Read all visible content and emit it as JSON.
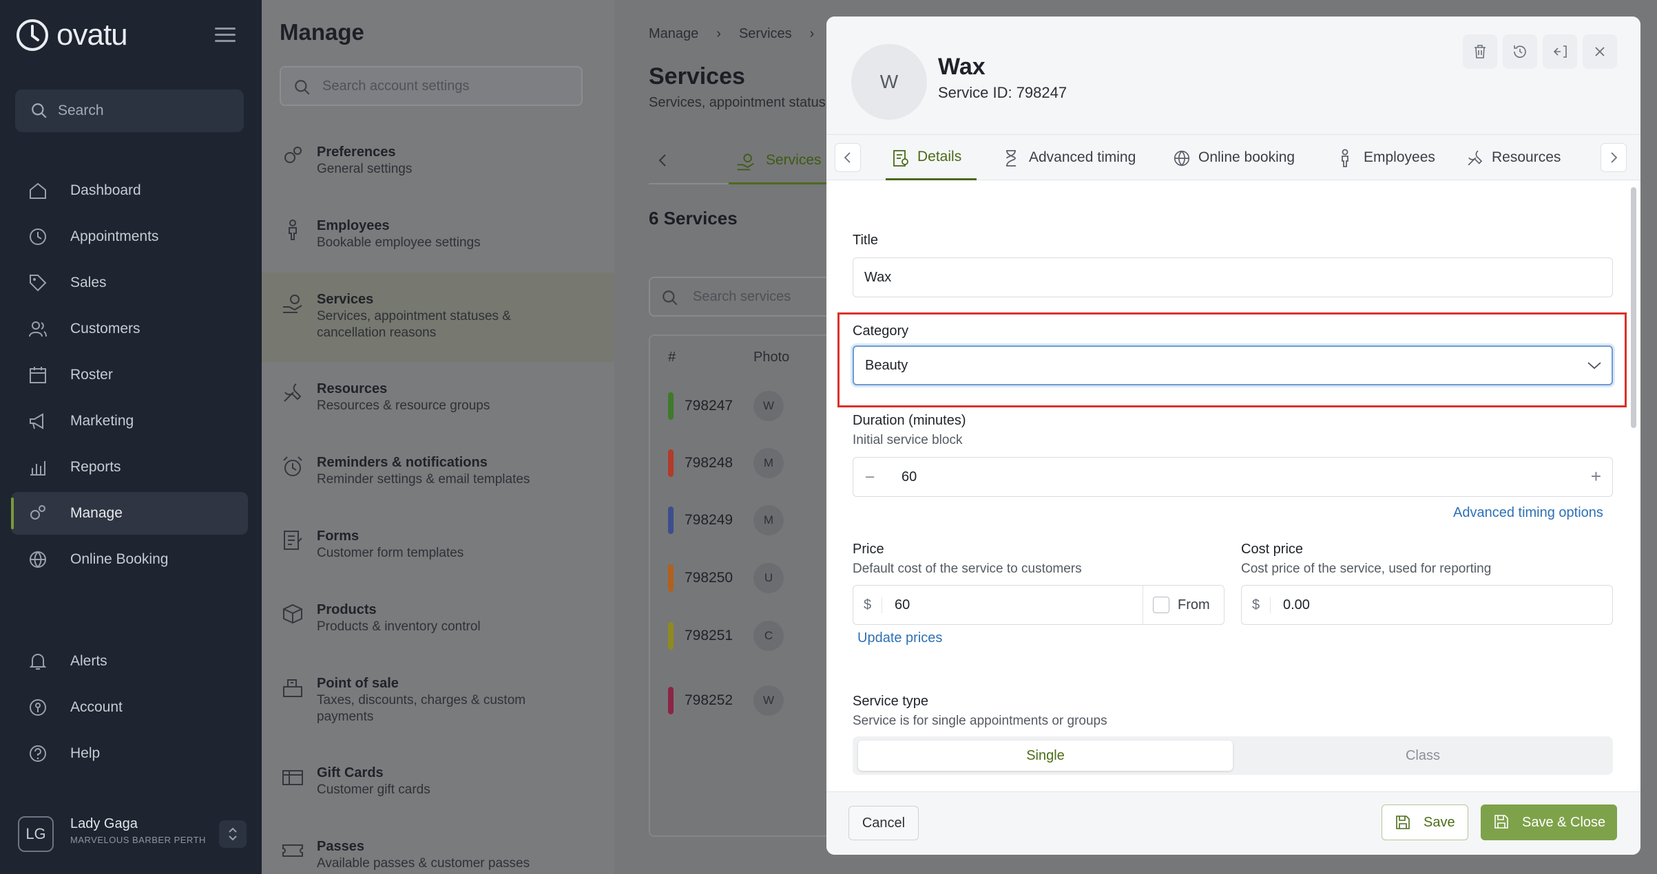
{
  "brand": {
    "name": "ovatu"
  },
  "sidebar": {
    "search_label": "Search",
    "items": [
      {
        "label": "Dashboard",
        "icon": "home-icon"
      },
      {
        "label": "Appointments",
        "icon": "clock-icon"
      },
      {
        "label": "Sales",
        "icon": "tag-icon"
      },
      {
        "label": "Customers",
        "icon": "users-icon"
      },
      {
        "label": "Roster",
        "icon": "calendar-icon"
      },
      {
        "label": "Marketing",
        "icon": "megaphone-icon"
      },
      {
        "label": "Reports",
        "icon": "chart-icon"
      },
      {
        "label": "Manage",
        "icon": "gears-icon",
        "active": true
      },
      {
        "label": "Online Booking",
        "icon": "globe-icon"
      },
      {
        "label": "Alerts",
        "icon": "bell-icon"
      },
      {
        "label": "Account",
        "icon": "account-icon"
      },
      {
        "label": "Help",
        "icon": "help-icon"
      }
    ],
    "user": {
      "initials": "LG",
      "name": "Lady Gaga",
      "org": "MARVELOUS BARBER PERTH"
    }
  },
  "manage": {
    "title": "Manage",
    "search_placeholder": "Search account settings",
    "items": [
      {
        "title": "Preferences",
        "subtitle": "General settings"
      },
      {
        "title": "Employees",
        "subtitle": "Bookable employee settings"
      },
      {
        "title": "Services",
        "subtitle": "Services, appointment statuses & cancellation reasons",
        "active": true
      },
      {
        "title": "Resources",
        "subtitle": "Resources & resource groups"
      },
      {
        "title": "Reminders & notifications",
        "subtitle": "Reminder settings & email templates"
      },
      {
        "title": "Forms",
        "subtitle": "Customer form templates"
      },
      {
        "title": "Products",
        "subtitle": "Products & inventory control"
      },
      {
        "title": "Point of sale",
        "subtitle": "Taxes, discounts, charges & custom payments"
      },
      {
        "title": "Gift Cards",
        "subtitle": "Customer gift cards"
      },
      {
        "title": "Passes",
        "subtitle": "Available passes & customer passes"
      }
    ]
  },
  "services_page": {
    "breadcrumb": [
      "Manage",
      "Services"
    ],
    "title": "Services",
    "subtitle": "Services, appointment status",
    "tab_label": "Services",
    "count_label": "6 Services",
    "search_placeholder": "Search services",
    "columns": [
      "#",
      "Photo"
    ],
    "rows": [
      {
        "id": "798247",
        "initial": "W",
        "color": "#3f7a2a"
      },
      {
        "id": "798248",
        "initial": "M",
        "color": "#b23b2a"
      },
      {
        "id": "798249",
        "initial": "M",
        "color": "#3c4f8c"
      },
      {
        "id": "798250",
        "initial": "U",
        "color": "#b0611d"
      },
      {
        "id": "798251",
        "initial": "C",
        "color": "#8f8a1e"
      },
      {
        "id": "798252",
        "initial": "W",
        "color": "#8c2545"
      }
    ]
  },
  "modal": {
    "avatar_initial": "W",
    "title": "Wax",
    "service_id": "Service ID: 798247",
    "tabs": [
      {
        "label": "Details",
        "active": true
      },
      {
        "label": "Advanced timing"
      },
      {
        "label": "Online booking"
      },
      {
        "label": "Employees"
      },
      {
        "label": "Resources"
      }
    ],
    "fields": {
      "title_label": "Title",
      "title_value": "Wax",
      "category_label": "Category",
      "category_value": "Beauty",
      "duration_label": "Duration (minutes)",
      "duration_sub": "Initial service block",
      "duration_value": "60",
      "advanced_link": "Advanced timing options",
      "price_label": "Price",
      "price_sub": "Default cost of the service to customers",
      "price_currency": "$",
      "price_value": "60",
      "from_label": "From",
      "cost_label": "Cost price",
      "cost_sub": "Cost price of the service, used for reporting",
      "cost_currency": "$",
      "cost_value": "0.00",
      "update_prices": "Update prices",
      "service_type_label": "Service type",
      "service_type_sub": "Service is for single appointments or groups",
      "type_single": "Single",
      "type_class": "Class"
    },
    "footer": {
      "cancel": "Cancel",
      "save": "Save",
      "save_close": "Save & Close"
    }
  }
}
